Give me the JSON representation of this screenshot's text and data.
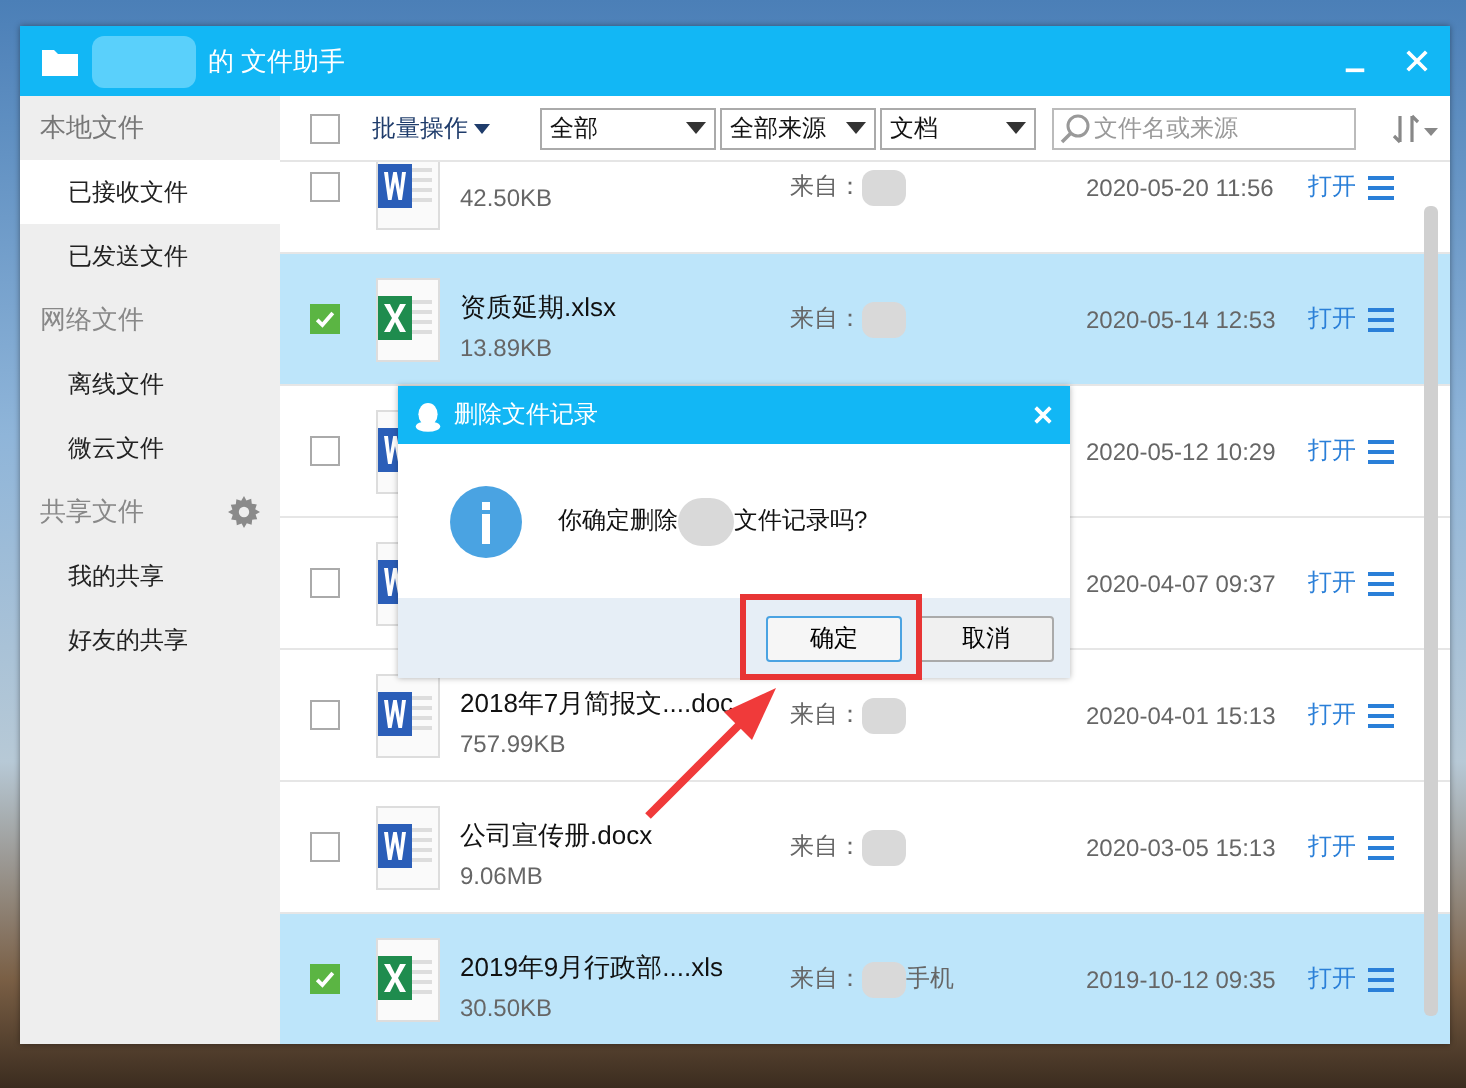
{
  "window": {
    "title": "的 文件助手"
  },
  "sidebar": {
    "sections": [
      {
        "label": "本地文件",
        "selected": true,
        "settings": false,
        "items": [
          {
            "label": "已接收文件",
            "selected": true
          },
          {
            "label": "已发送文件",
            "selected": false
          }
        ]
      },
      {
        "label": "网络文件",
        "selected": false,
        "settings": false,
        "items": [
          {
            "label": "离线文件",
            "selected": false
          },
          {
            "label": "微云文件",
            "selected": false
          }
        ]
      },
      {
        "label": "共享文件",
        "selected": false,
        "settings": true,
        "items": [
          {
            "label": "我的共享",
            "selected": false
          },
          {
            "label": "好友的共享",
            "selected": false
          }
        ]
      }
    ]
  },
  "toolbar": {
    "select_all": {
      "checked": false
    },
    "batch": "批量操作",
    "filters": [
      "全部",
      "全部来源",
      "文档"
    ],
    "search": {
      "placeholder": "文件名或来源"
    }
  },
  "rows": [
    {
      "kind": "word",
      "name": "",
      "size": "42.50KB",
      "source": "来自：",
      "source_tail": "",
      "date": "2020-05-20 11:56",
      "open": "打开",
      "checked": false
    },
    {
      "kind": "excel",
      "name": "资质延期.xlsx",
      "size": "13.89KB",
      "source": "来自：",
      "source_tail": "",
      "date": "2020-05-14 12:53",
      "open": "打开",
      "checked": true
    },
    {
      "kind": "word",
      "name": "",
      "size": "",
      "source": "",
      "source_tail": "",
      "date": "2020-05-12 10:29",
      "open": "打开",
      "checked": false
    },
    {
      "kind": "word",
      "name": "",
      "size": "",
      "source": "",
      "source_tail": "",
      "date": "2020-04-07 09:37",
      "open": "打开",
      "checked": false
    },
    {
      "kind": "word",
      "name": "2018年7月简报文....doc",
      "size": "757.99KB",
      "source": "来自：",
      "source_tail": "",
      "date": "2020-04-01 15:13",
      "open": "打开",
      "checked": false
    },
    {
      "kind": "word",
      "name": "公司宣传册.docx",
      "size": "9.06MB",
      "source": "来自：",
      "source_tail": "",
      "date": "2020-03-05 15:13",
      "open": "打开",
      "checked": false
    },
    {
      "kind": "excel",
      "name": "2019年9月行政部....xls",
      "size": "30.50KB",
      "source": "来自：",
      "source_tail": "手机",
      "date": "2019-10-12 09:35",
      "open": "打开",
      "checked": true
    }
  ],
  "dialog": {
    "title": "删除文件记录",
    "message_start": "你确定删除",
    "message_end": "文件记录吗?",
    "buttons": [
      {
        "label": "确定",
        "selected": true
      },
      {
        "label": "取消",
        "selected": false
      }
    ]
  }
}
